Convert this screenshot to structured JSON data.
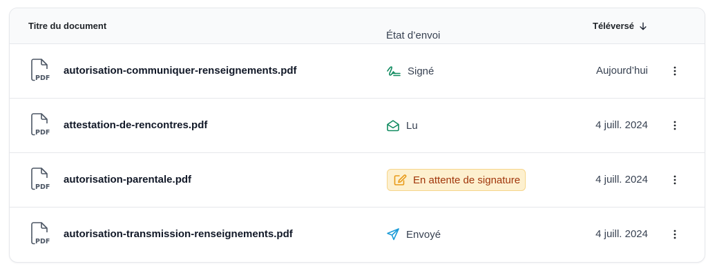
{
  "table": {
    "headers": {
      "title": "Titre du document",
      "status": "État d’envoi",
      "uploaded": "Téléversé"
    },
    "rows": [
      {
        "name": "autorisation-communiquer-renseignements.pdf",
        "file_badge": "PDF",
        "status": "Signé",
        "status_icon": "signature-icon",
        "date": "Aujourd’hui"
      },
      {
        "name": "attestation-de-rencontres.pdf",
        "file_badge": "PDF",
        "status": "Lu",
        "status_icon": "envelope-open-icon",
        "date": "4 juill. 2024"
      },
      {
        "name": "autorisation-parentale.pdf",
        "file_badge": "PDF",
        "status": "En attente de signature",
        "status_icon": "edit-icon",
        "date": "4 juill. 2024"
      },
      {
        "name": "autorisation-transmission-renseignements.pdf",
        "file_badge": "PDF",
        "status": "Envoyé",
        "status_icon": "send-icon",
        "date": "4 juill. 2024"
      }
    ]
  },
  "colors": {
    "signed": "#0f8a5f",
    "read": "#0f8a5f",
    "pending_text": "#a0350a",
    "pending_bg": "#fdf0cf",
    "pending_icon": "#e89a18",
    "sent": "#1a9bd7"
  }
}
